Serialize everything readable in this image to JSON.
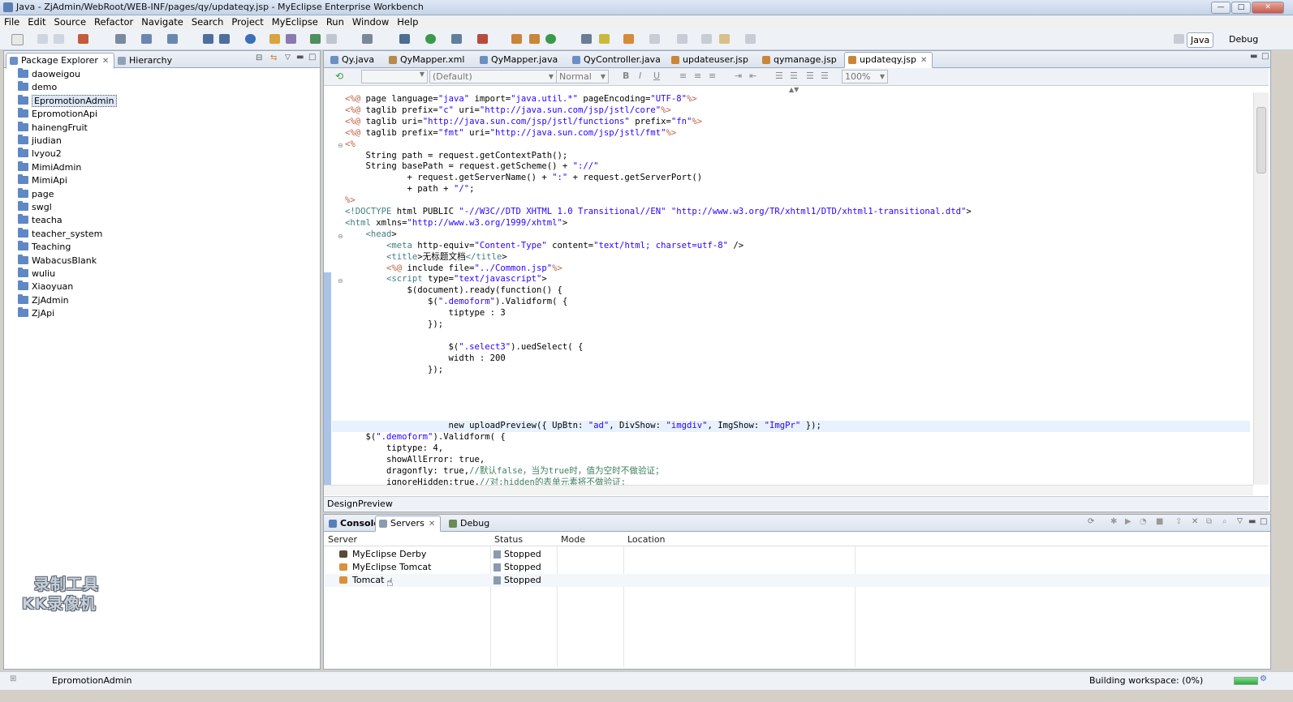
{
  "window": {
    "title": "Java - ZjAdmin/WebRoot/WEB-INF/pages/qy/updateqy.jsp - MyEclipse Enterprise Workbench",
    "minimize": "—",
    "maximize": "□",
    "close": "✕"
  },
  "menu": [
    "File",
    "Edit",
    "Source",
    "Refactor",
    "Navigate",
    "Search",
    "Project",
    "MyEclipse",
    "Run",
    "Window",
    "Help"
  ],
  "perspectives": {
    "java": "Java",
    "debug": "Debug"
  },
  "left_panel": {
    "tabs": [
      "Package Explorer",
      "Hierarchy"
    ],
    "projects": [
      "daoweigou",
      "demo",
      "EpromotionAdmin",
      "EpromotionApi",
      "hainengFruit",
      "jiudian",
      "lvyou2",
      "MimiAdmin",
      "MimiApi",
      "page",
      "swgl",
      "teacha",
      "teacher_system",
      "Teaching",
      "WabacusBlank",
      "wuliu",
      "Xiaoyuan",
      "ZjAdmin",
      "ZjApi"
    ],
    "selected": "EpromotionAdmin"
  },
  "editor": {
    "tabs": [
      "Qy.java",
      "QyMapper.xml",
      "QyMapper.java",
      "QyController.java",
      "updateuser.jsp",
      "qymanage.jsp",
      "updateqy.jsp"
    ],
    "active_tab": "updateqy.jsp",
    "format_bar": {
      "style_select": "(Default)",
      "para_select": "Normal",
      "zoom": "100%",
      "bold": "B",
      "italic": "I",
      "underline": "U"
    },
    "bottom_tabs": [
      "Design",
      "Preview"
    ]
  },
  "code_lines": [
    "<%@ page language=\"java\" import=\"java.util.*\" pageEncoding=\"UTF-8\"%>",
    "<%@ taglib prefix=\"c\" uri=\"http://java.sun.com/jsp/jstl/core\"%>",
    "<%@ taglib uri=\"http://java.sun.com/jsp/jstl/functions\" prefix=\"fn\"%>",
    "<%@ taglib prefix=\"fmt\" uri=\"http://java.sun.com/jsp/jstl/fmt\"%>",
    "<%",
    "    String path = request.getContextPath();",
    "    String basePath = request.getScheme() + \"://\"",
    "            + request.getServerName() + \":\" + request.getServerPort()",
    "            + path + \"/\";",
    "%>",
    "<!DOCTYPE html PUBLIC \"-//W3C//DTD XHTML 1.0 Transitional//EN\" \"http://www.w3.org/TR/xhtml1/DTD/xhtml1-transitional.dtd\">",
    "<html xmlns=\"http://www.w3.org/1999/xhtml\">",
    "    <head>",
    "        <meta http-equiv=\"Content-Type\" content=\"text/html; charset=utf-8\" />",
    "        <title>无标题文档</title>",
    "        <%@ include file=\"../Common.jsp\"%>",
    "        <script type=\"text/javascript\">",
    "            $(document).ready(function() {",
    "                $(\".demoform\").Validform( {",
    "                    tiptype : 3",
    "                });",
    "",
    "                    $(\".select3\").uedSelect( {",
    "                    width : 200",
    "                });",
    "",
    "",
    "",
    "",
    "                    new uploadPreview({ UpBtn: \"ad\", DivShow: \"imgdiv\", ImgShow: \"ImgPr\" });",
    "    $(\".demoform\").Validform( {",
    "        tiptype: 4,",
    "        showAllError: true,",
    "        dragonfly: true,//默认false，当为true时，值为空时不做验证；",
    "        ignoreHidden:true,//对:hidden的表单元素将不做验证;"
  ],
  "bottom_panel": {
    "tabs": [
      "Console",
      "Servers",
      "Debug"
    ],
    "active_tab": "Servers",
    "columns": [
      "Server",
      "Status",
      "Mode",
      "Location"
    ],
    "servers": [
      {
        "name": "MyEclipse Derby",
        "status": "Stopped"
      },
      {
        "name": "MyEclipse Tomcat",
        "status": "Stopped"
      },
      {
        "name": "Tomcat",
        "status": "Stopped"
      }
    ]
  },
  "status_bar": {
    "selected_project": "EpromotionAdmin",
    "task": "Building workspace: (0%)"
  },
  "watermark": {
    "line1": "录制工具",
    "line2": "KK录像机"
  },
  "colors": {
    "title_blue": "#c5d3e8",
    "selection": "#dde8f7",
    "jsp_directive": "#bf5f3f",
    "tag": "#3f7f7f",
    "string": "#2a00ff",
    "comment": "#3f7f5f"
  }
}
